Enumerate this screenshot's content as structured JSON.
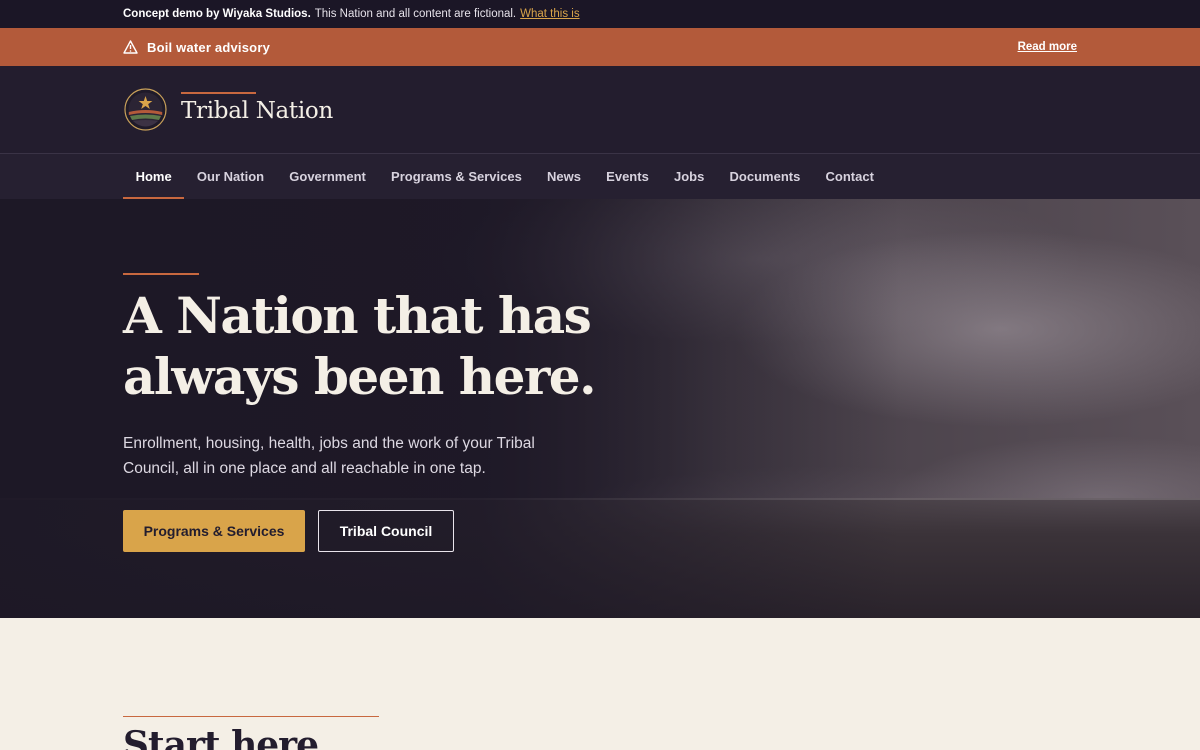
{
  "demo_bar": {
    "strong": "Concept demo by Wiyaka Studios.",
    "text": "This Nation and all content are fictional.",
    "link": "What this is"
  },
  "alert": {
    "icon": "warning-triangle-icon",
    "title": "Boil water advisory",
    "link": "Read more"
  },
  "header": {
    "brand": "Tribal Nation",
    "logo": "nation-seal"
  },
  "nav": {
    "items": [
      {
        "label": "Home"
      },
      {
        "label": "Our Nation"
      },
      {
        "label": "Government"
      },
      {
        "label": "Programs & Services"
      },
      {
        "label": "News"
      },
      {
        "label": "Events"
      },
      {
        "label": "Jobs"
      },
      {
        "label": "Documents"
      },
      {
        "label": "Contact"
      }
    ],
    "active": "Home"
  },
  "hero": {
    "title": "A Nation that has always been here.",
    "subtitle": "Enrollment, housing, health, jobs and the work of your Tribal Council, all in one place and all reachable in one tap.",
    "primary_button": "Programs & Services",
    "secondary_button": "Tribal Council"
  },
  "section": {
    "title": "Start here"
  },
  "colors": {
    "accent": "#c8683f",
    "gold": "#d9a44a",
    "dark": "#231d2e",
    "alert": "#b35a3a",
    "cream": "#f4efe6"
  }
}
